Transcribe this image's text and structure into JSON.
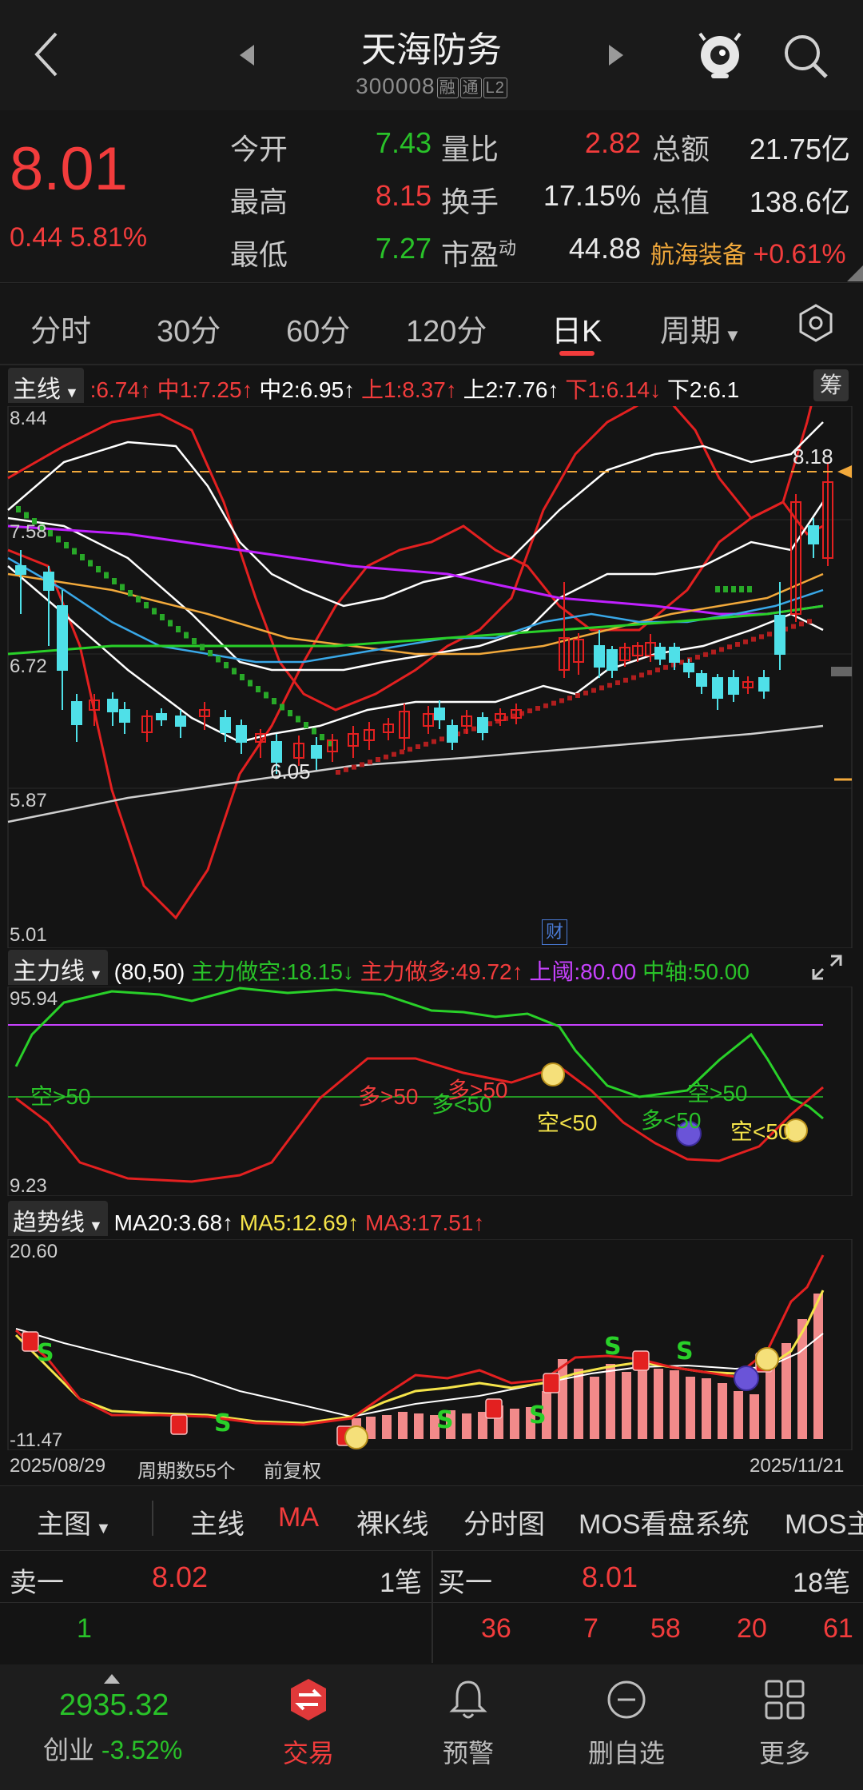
{
  "header": {
    "title": "天海防务",
    "code": "300008",
    "tags": [
      "融",
      "通",
      "L2"
    ]
  },
  "quote": {
    "price": "8.01",
    "change": "0.44",
    "change_pct": "5.81%",
    "open_label": "今开",
    "open": "7.43",
    "high_label": "最高",
    "high": "8.15",
    "low_label": "最低",
    "low": "7.27",
    "vol_ratio_label": "量比",
    "vol_ratio": "2.82",
    "turnover_label": "换手",
    "turnover": "17.15%",
    "pe_label": "市盈",
    "pe_sup": "动",
    "pe": "44.88",
    "amount_label": "总额",
    "amount": "21.75亿",
    "mktcap_label": "总值",
    "mktcap": "138.6亿",
    "sector": "航海装备",
    "sector_pct": "+0.61%"
  },
  "tabs": [
    "分时",
    "30分",
    "60分",
    "120分",
    "日K",
    "周期"
  ],
  "active_tab": "日K",
  "main_chart": {
    "selector": "主线",
    "legend": [
      {
        "text": ":6.74↑",
        "color": "#f23c3c"
      },
      {
        "text": "中1:7.25↑",
        "color": "#f23c3c"
      },
      {
        "text": "中2:6.95↑",
        "color": "#ffffff"
      },
      {
        "text": "上1:8.37↑",
        "color": "#f23c3c"
      },
      {
        "text": "上2:7.76↑",
        "color": "#ffffff"
      },
      {
        "text": "下1:6.14↓",
        "color": "#f23c3c"
      },
      {
        "text": "下2:6.1",
        "color": "#ffffff"
      }
    ],
    "chip_btn": "筹",
    "y_labels": [
      "8.44",
      "7.58",
      "6.72",
      "5.87",
      "5.01"
    ],
    "high_mark": "8.18",
    "low_mark": "6.05",
    "fin_badge": "财",
    "dashed_level": 8.18
  },
  "force_chart": {
    "selector": "主力线",
    "legend": [
      {
        "text": "(80,50)",
        "color": "#ffffff"
      },
      {
        "text": "主力做空:18.15↓",
        "color": "#29c229"
      },
      {
        "text": "主力做多:49.72↑",
        "color": "#f23c3c"
      },
      {
        "text": "上阈:80.00",
        "color": "#c842ff"
      },
      {
        "text": "中轴:50.00",
        "color": "#29c229"
      }
    ],
    "y_labels": [
      "95.94",
      "9.23"
    ],
    "annotations": [
      {
        "text": "空>50",
        "color": "#29c229"
      },
      {
        "text": "多>50",
        "color": "#f23c3c"
      },
      {
        "text": "多<50",
        "color": "#29c229"
      },
      {
        "text": "多>50",
        "color": "#f23c3c"
      },
      {
        "text": "空<50",
        "color": "#f5e44a"
      },
      {
        "text": "多<50",
        "color": "#29c229"
      },
      {
        "text": "空>50",
        "color": "#29c229"
      },
      {
        "text": "空<50",
        "color": "#f5e44a"
      }
    ]
  },
  "trend_chart": {
    "selector": "趋势线",
    "legend": [
      {
        "text": "MA20:3.68↑",
        "color": "#ffffff"
      },
      {
        "text": "MA5:12.69↑",
        "color": "#f5e44a"
      },
      {
        "text": "MA3:17.51↑",
        "color": "#f23c3c"
      }
    ],
    "y_labels": [
      "20.60",
      "-11.47"
    ],
    "date_start": "2025/08/29",
    "period_count": "周期数55个",
    "adjust": "前复权",
    "date_end": "2025/11/21"
  },
  "bottom_menu": [
    "主图",
    "主线",
    "MA",
    "裸K线",
    "分时图",
    "MOS看盘系统",
    "MOS主"
  ],
  "order_book": {
    "sell_label": "卖一",
    "sell_price": "8.02",
    "sell_count": "1笔",
    "buy_label": "买一",
    "buy_price": "8.01",
    "buy_count": "18笔",
    "sell_queue": [
      "1"
    ],
    "buy_queue": [
      "36",
      "7",
      "58",
      "20",
      "61"
    ]
  },
  "nav": {
    "index_value": "2935.32",
    "index_name": "创业",
    "index_pct": "-3.52%",
    "items": [
      "交易",
      "预警",
      "删自选",
      "更多"
    ]
  },
  "colors": {
    "up": "#f23c3c",
    "down": "#29c229",
    "bg": "#141414"
  }
}
